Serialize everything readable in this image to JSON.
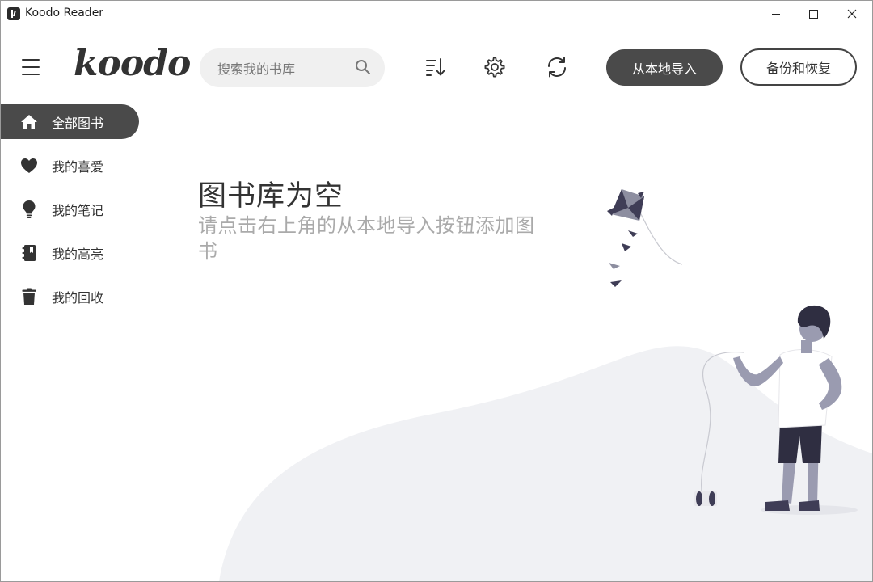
{
  "window": {
    "title": "Koodo Reader"
  },
  "header": {
    "logo": "koodo",
    "search_placeholder": "搜索我的书库",
    "import_label": "从本地导入",
    "backup_label": "备份和恢复"
  },
  "sidebar": {
    "items": [
      {
        "label": "全部图书",
        "icon": "home-icon",
        "active": true
      },
      {
        "label": "我的喜爱",
        "icon": "heart-icon",
        "active": false
      },
      {
        "label": "我的笔记",
        "icon": "lightbulb-icon",
        "active": false
      },
      {
        "label": "我的高亮",
        "icon": "notebook-icon",
        "active": false
      },
      {
        "label": "我的回收",
        "icon": "trash-icon",
        "active": false
      }
    ]
  },
  "empty_state": {
    "title": "图书库为空",
    "subtitle": "请点击右上角的从本地导入按钮添加图书"
  },
  "colors": {
    "accent": "#4a4a4a",
    "hill": "#f0f1f4",
    "figure_dark": "#2f2e41"
  }
}
